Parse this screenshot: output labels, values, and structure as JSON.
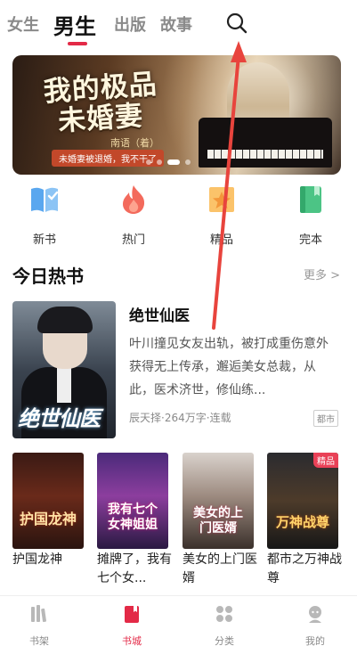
{
  "tabs": [
    "女生",
    "男生",
    "出版",
    "故事"
  ],
  "active_tab": "男生",
  "banner": {
    "title_line1": "我的极品",
    "title_line2": "未婚妻",
    "author": "南语（着）",
    "tagline": "未婚妻被退婚，我不干了",
    "slide_count": 4,
    "active_slide": 2
  },
  "categories": [
    {
      "label": "新书",
      "icon": "book-icon",
      "color": "#4a9be8"
    },
    {
      "label": "热门",
      "icon": "fire-icon",
      "color": "#f0524f"
    },
    {
      "label": "精品",
      "icon": "star-icon",
      "color": "#f5a623"
    },
    {
      "label": "完本",
      "icon": "finished-book-icon",
      "color": "#3cb878"
    }
  ],
  "section": {
    "title": "今日热书",
    "more": "更多 >"
  },
  "featured": {
    "cover_text": "绝世仙医",
    "title": "绝世仙医",
    "description": "叶川撞见女友出轨，被打成重伤意外获得无上传承，邂逅美女总裁，从此，医术济世，修仙练...",
    "author": "辰天择",
    "word_count": "264万字",
    "status": "连载",
    "separator": "·",
    "tag": "都市"
  },
  "books": [
    {
      "title": "护国龙神",
      "cover_text": "护国龙神",
      "badge": ""
    },
    {
      "title": "摊牌了，我有七个女...",
      "cover_text": "我有七个女神姐姐",
      "badge": ""
    },
    {
      "title": "美女的上门医婿",
      "cover_text": "美女的上门医婿",
      "badge": ""
    },
    {
      "title": "都市之万神战尊",
      "cover_text": "万神战尊",
      "badge": "精品"
    }
  ],
  "nav": [
    {
      "label": "书架",
      "icon": "bookshelf-icon",
      "active": false
    },
    {
      "label": "书城",
      "icon": "bookstore-icon",
      "active": true
    },
    {
      "label": "分类",
      "icon": "category-icon",
      "active": false
    },
    {
      "label": "我的",
      "icon": "profile-icon",
      "active": false
    }
  ],
  "accent_color": "#e32a47"
}
